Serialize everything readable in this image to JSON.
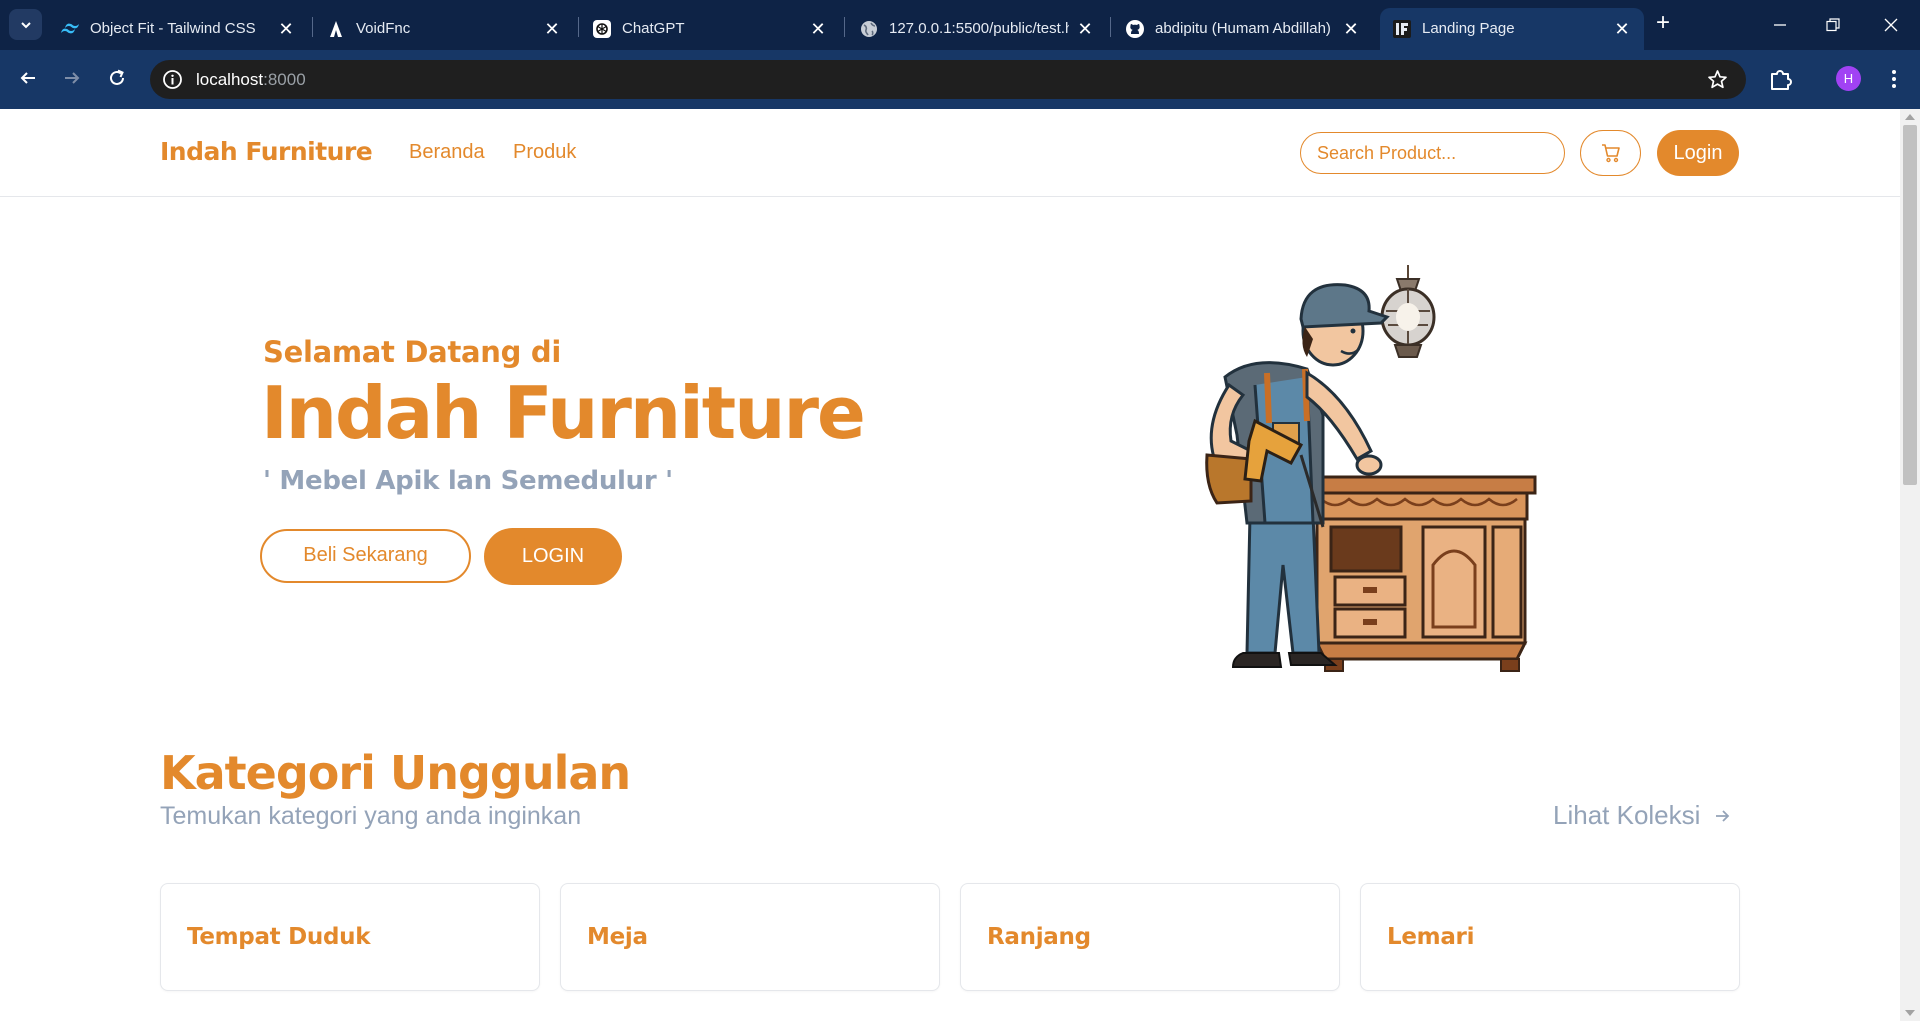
{
  "browser": {
    "tabs": [
      {
        "title": "Object Fit - Tailwind CSS",
        "icon": "tailwind-icon"
      },
      {
        "title": "VoidFnc",
        "icon": "voidfnc-icon"
      },
      {
        "title": "ChatGPT",
        "icon": "chatgpt-icon"
      },
      {
        "title": "127.0.0.1:5500/public/test.h",
        "icon": "globe-icon"
      },
      {
        "title": "abdipitu (Humam Abdillah)",
        "icon": "github-icon"
      },
      {
        "title": "Landing Page",
        "icon": "favicon-if-icon",
        "active": true
      }
    ],
    "url_host": "localhost",
    "url_port": ":8000",
    "profile_initial": "H"
  },
  "header": {
    "brand": "Indah Furniture",
    "nav": [
      "Beranda",
      "Produk"
    ],
    "search_placeholder": "Search Product...",
    "login_label": "Login"
  },
  "hero": {
    "greeting": "Selamat Datang di",
    "title": "Indah Furniture",
    "tagline": "' Mebel Apik lan Semedulur '",
    "buy_label": "Beli Sekarang",
    "login_label": "LOGIN"
  },
  "categories": {
    "title": "Kategori Unggulan",
    "subtitle": "Temukan kategori yang anda inginkan",
    "see_all": "Lihat Koleksi",
    "items": [
      "Tempat Duduk",
      "Meja",
      "Ranjang",
      "Lemari"
    ]
  },
  "colors": {
    "accent": "#e3892c",
    "muted": "#94a3b8",
    "tabstrip": "#0e2346",
    "toolbar": "#173766"
  }
}
